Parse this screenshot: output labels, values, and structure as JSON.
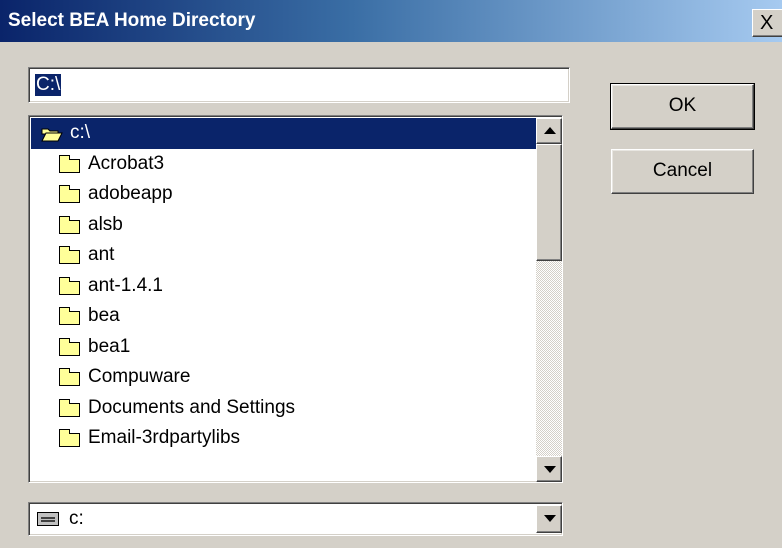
{
  "window": {
    "title": "Select BEA Home Directory",
    "close_glyph": "X"
  },
  "path_field": {
    "value": "C:\\"
  },
  "buttons": {
    "ok": "OK",
    "cancel": "Cancel"
  },
  "folder_list": {
    "selected_index": 0,
    "items": [
      {
        "label": "c:\\",
        "icon": "open-folder-icon",
        "level": 0
      },
      {
        "label": "Acrobat3",
        "icon": "folder-icon",
        "level": 1
      },
      {
        "label": "adobeapp",
        "icon": "folder-icon",
        "level": 1
      },
      {
        "label": "alsb",
        "icon": "folder-icon",
        "level": 1
      },
      {
        "label": "ant",
        "icon": "folder-icon",
        "level": 1
      },
      {
        "label": "ant-1.4.1",
        "icon": "folder-icon",
        "level": 1
      },
      {
        "label": "bea",
        "icon": "folder-icon",
        "level": 1
      },
      {
        "label": "bea1",
        "icon": "folder-icon",
        "level": 1
      },
      {
        "label": "Compuware",
        "icon": "folder-icon",
        "level": 1
      },
      {
        "label": "Documents and Settings",
        "icon": "folder-icon",
        "level": 1
      },
      {
        "label": "Email-3rdpartylibs",
        "icon": "folder-icon",
        "level": 1
      }
    ]
  },
  "drive_select": {
    "value": "c:",
    "icon": "drive-icon"
  },
  "colors": {
    "dialog_bg": "#d4d0c8",
    "selection": "#0a246a",
    "title_gradient_start": "#0a246a",
    "title_gradient_end": "#a6caf0"
  }
}
